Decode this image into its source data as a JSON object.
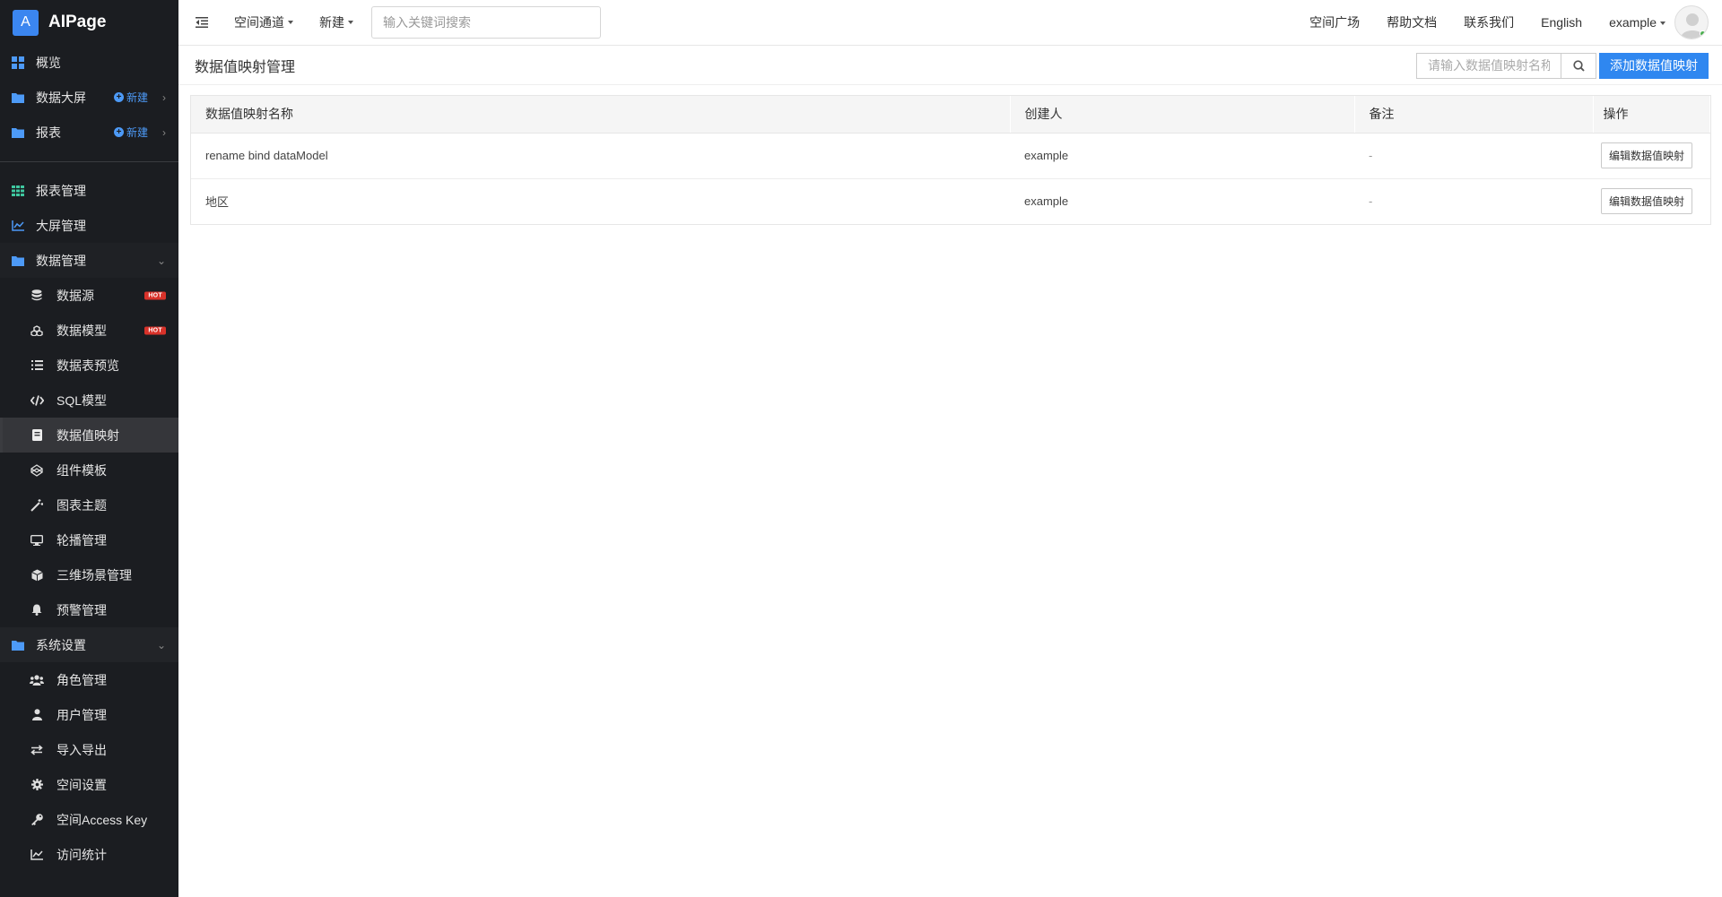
{
  "app": {
    "logo_letter": "A",
    "name": "AIPage"
  },
  "sidebar": {
    "top_items": [
      {
        "label": "概览",
        "icon": "dashboard-icon"
      },
      {
        "label": "数据大屏",
        "icon": "folder-icon",
        "new_label": "新建"
      },
      {
        "label": "报表",
        "icon": "folder-icon",
        "new_label": "新建"
      }
    ],
    "items": [
      {
        "label": "报表管理",
        "icon": "grid-icon"
      },
      {
        "label": "大屏管理",
        "icon": "line-chart-icon"
      },
      {
        "label": "数据管理",
        "icon": "folder-icon"
      }
    ],
    "data_sub": [
      {
        "label": "数据源",
        "icon": "database-icon",
        "badge": "HOT"
      },
      {
        "label": "数据模型",
        "icon": "cubes-icon",
        "badge": "HOT"
      },
      {
        "label": "数据表预览",
        "icon": "list-icon"
      },
      {
        "label": "SQL模型",
        "icon": "code-icon"
      },
      {
        "label": "数据值映射",
        "icon": "book-icon",
        "active": true
      },
      {
        "label": "组件模板",
        "icon": "codepen-icon"
      },
      {
        "label": "图表主题",
        "icon": "magic-icon"
      },
      {
        "label": "轮播管理",
        "icon": "desktop-icon"
      },
      {
        "label": "三维场景管理",
        "icon": "cube-icon"
      },
      {
        "label": "预警管理",
        "icon": "bell-icon"
      }
    ],
    "system": {
      "label": "系统设置",
      "icon": "folder-icon"
    },
    "system_sub": [
      {
        "label": "角色管理",
        "icon": "users-icon"
      },
      {
        "label": "用户管理",
        "icon": "user-icon"
      },
      {
        "label": "导入导出",
        "icon": "exchange-icon"
      },
      {
        "label": "空间设置",
        "icon": "gear-icon"
      },
      {
        "label": "空间Access Key",
        "icon": "key-icon"
      },
      {
        "label": "访问统计",
        "icon": "line-chart-icon"
      }
    ]
  },
  "topbar": {
    "space_channel": "空间通道",
    "new": "新建",
    "search_placeholder": "输入关键词搜索",
    "links": [
      "空间广场",
      "帮助文档",
      "联系我们",
      "English"
    ],
    "user": "example"
  },
  "page": {
    "title": "数据值映射管理",
    "search_placeholder": "请输入数据值映射名称",
    "add_button": "添加数据值映射"
  },
  "table": {
    "columns": [
      "数据值映射名称",
      "创建人",
      "备注",
      "操作"
    ],
    "rows": [
      {
        "name": "rename bind dataModel",
        "creator": "example",
        "remark": "-",
        "action": "编辑数据值映射"
      },
      {
        "name": "地区",
        "creator": "example",
        "remark": "-",
        "action": "编辑数据值映射"
      }
    ]
  },
  "colors": {
    "sidebar_bg": "#1b1d21",
    "accent": "#2f87f0",
    "hot": "#d9322a"
  }
}
